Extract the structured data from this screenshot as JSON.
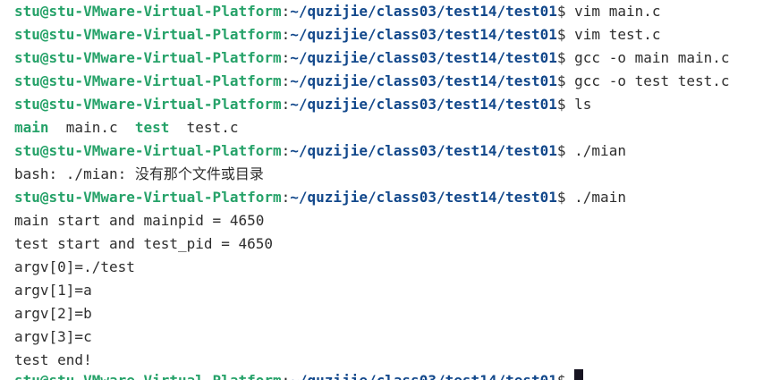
{
  "prompt": {
    "user_host": "stu@stu-VMware-Virtual-Platform",
    "sep": ":",
    "cwd": "~/quzijie/class03/test14/test01",
    "symbol": "$ "
  },
  "lines": {
    "l1_cmd": "vim main.c",
    "l2_cmd": "vim test.c",
    "l3_cmd": "gcc -o main main.c",
    "l4_cmd": "gcc -o test test.c",
    "l5_cmd": "ls",
    "ls_main": "main",
    "ls_main_c": "main.c",
    "ls_test": "test",
    "ls_test_c": "test.c",
    "l7_cmd": "./mian",
    "l8_out": "bash: ./mian: 没有那个文件或目录",
    "l9_cmd": "./main",
    "l10_out": "main start and mainpid = 4650",
    "l11_out": "test start and test_pid = 4650",
    "l12_out": "argv[0]=./test",
    "l13_out": "argv[1]=a",
    "l14_out": "argv[2]=b",
    "l15_out": "argv[3]=c",
    "l16_out": "test end!"
  },
  "colors": {
    "prompt_user": "#26a269",
    "prompt_path": "#12488b",
    "executable": "#26a269",
    "text": "#2e2e2e",
    "background": "#ffffff"
  }
}
